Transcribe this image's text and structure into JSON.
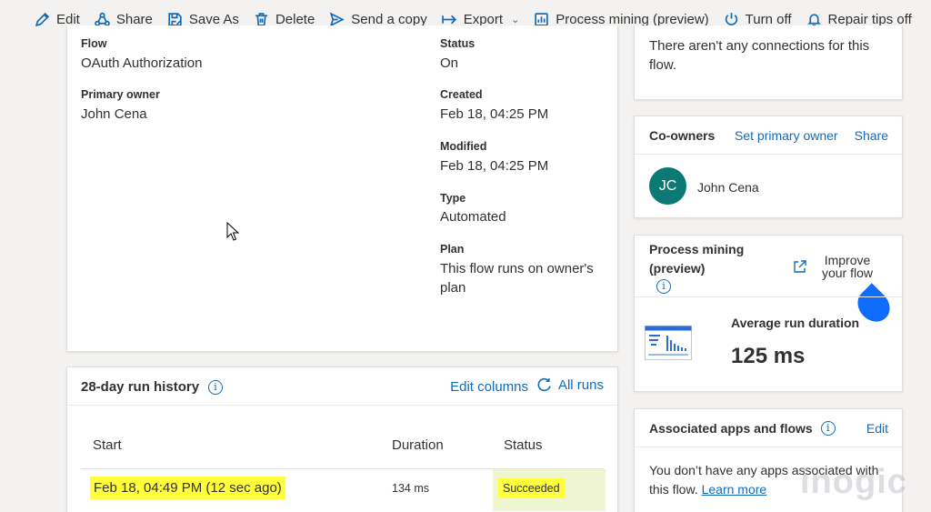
{
  "command_bar": {
    "edit": "Edit",
    "share": "Share",
    "save_as": "Save As",
    "delete": "Delete",
    "send_copy": "Send a copy",
    "export": "Export",
    "process_mining": "Process mining (preview)",
    "turn_off": "Turn off",
    "repair_tips": "Repair tips off"
  },
  "details": {
    "flow_label": "Flow",
    "flow_value": "OAuth Authorization",
    "owner_label": "Primary owner",
    "owner_value": "John Cena",
    "status_label": "Status",
    "status_value": "On",
    "created_label": "Created",
    "created_value": "Feb 18, 04:25 PM",
    "modified_label": "Modified",
    "modified_value": "Feb 18, 04:25 PM",
    "type_label": "Type",
    "type_value": "Automated",
    "plan_label": "Plan",
    "plan_value_line1": "This flow runs on owner's",
    "plan_value_line2": "plan"
  },
  "run_history": {
    "title": "28-day run history",
    "edit_columns": "Edit columns",
    "all_runs": "All runs",
    "columns": {
      "start": "Start",
      "duration": "Duration",
      "status": "Status"
    },
    "rows": [
      {
        "start": "Feb 18, 04:49 PM (12 sec ago)",
        "duration": "134 ms",
        "status": "Succeeded"
      }
    ]
  },
  "connections": {
    "text_line1": "There aren't any connections for this",
    "text_line2": "flow."
  },
  "coowners": {
    "title": "Co-owners",
    "set_primary": "Set primary owner",
    "share": "Share",
    "avatar_initials": "JC",
    "name": "John Cena",
    "avatar_color": "#0b7a75"
  },
  "process_mining": {
    "title_line1": "Process mining",
    "title_line2": "(preview)",
    "improve_line1": "Improve",
    "improve_line2": "your flow",
    "avg_label": "Average run duration",
    "avg_value": "125 ms"
  },
  "associated": {
    "title": "Associated apps and flows",
    "edit": "Edit",
    "text_line1": "You don’t have any apps associated with",
    "text_line2_prefix": "this flow.",
    "learn_more": "Learn more"
  },
  "watermark": "inogic"
}
